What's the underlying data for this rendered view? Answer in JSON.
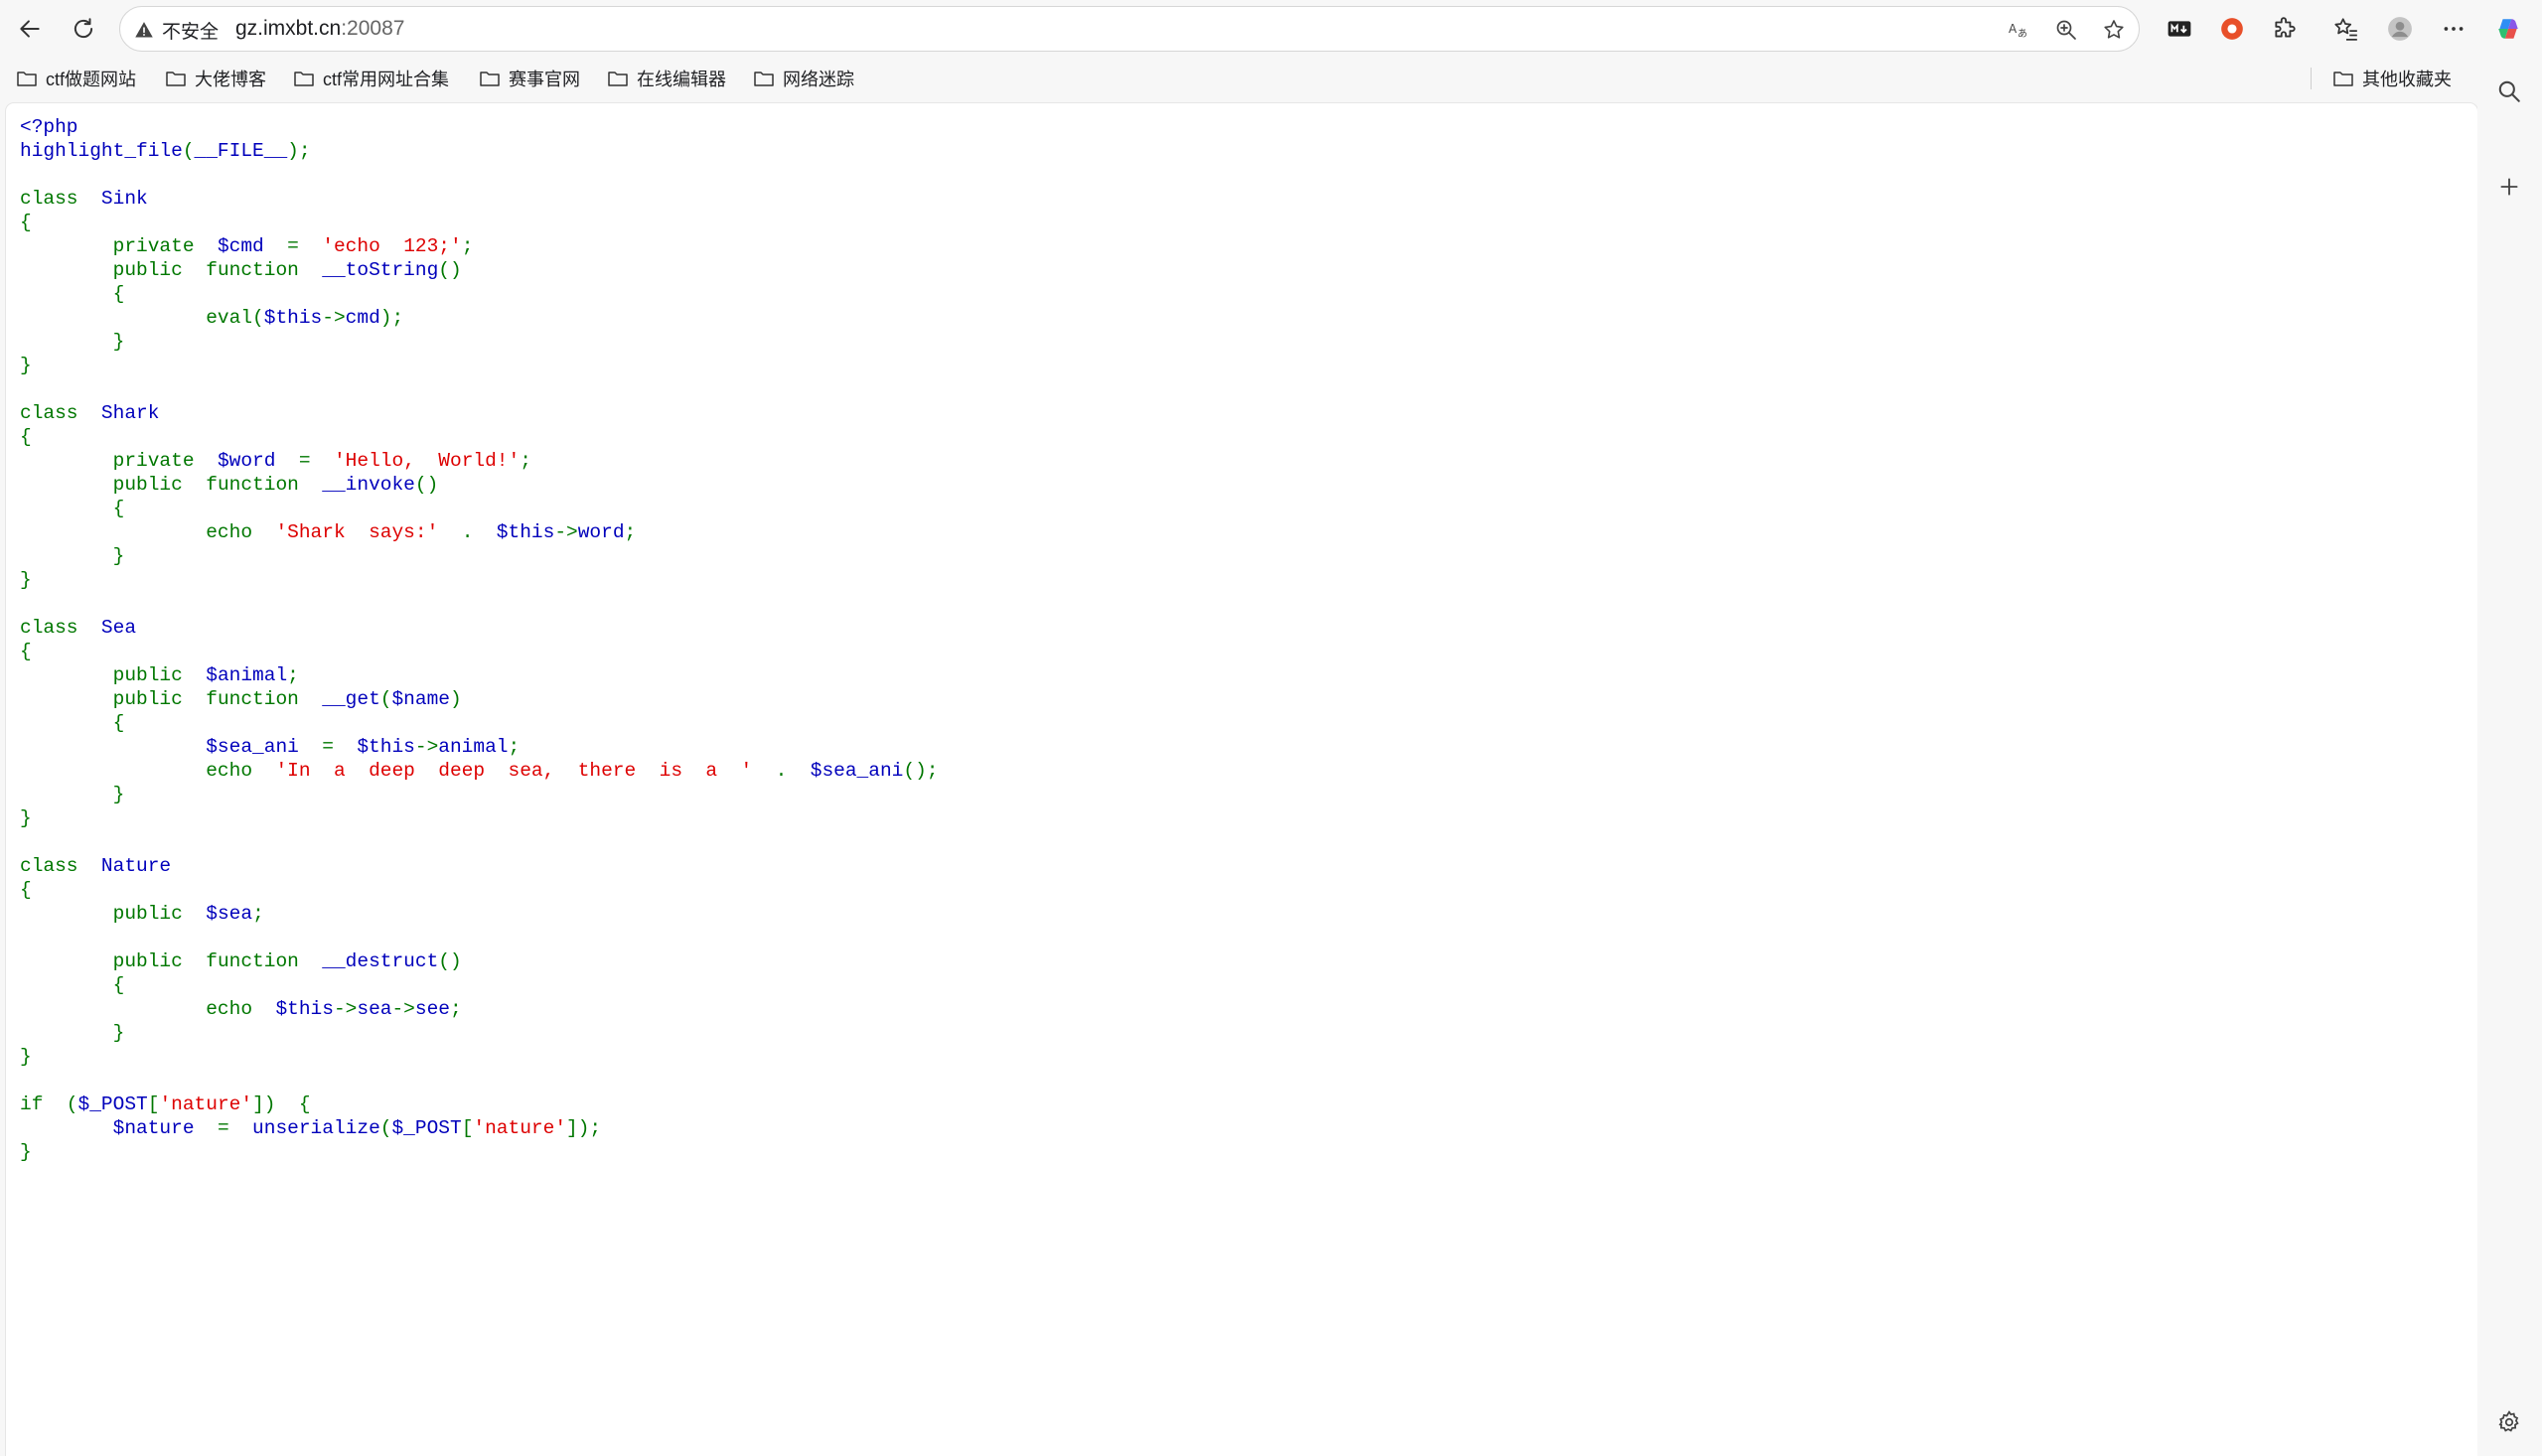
{
  "toolbar": {
    "security_label": "不安全",
    "url_host": "gz.imxbt.cn",
    "url_port": ":20087"
  },
  "bookmarks": [
    {
      "label": "ctf做题网站"
    },
    {
      "label": "大佬博客"
    },
    {
      "label": "ctf常用网址合集"
    },
    {
      "label": "赛事官网"
    },
    {
      "label": "在线编辑器"
    },
    {
      "label": "网络迷踪"
    }
  ],
  "other_bookmarks_label": "其他收藏夹",
  "code": {
    "lines": [
      [
        [
          "tag",
          "<?php"
        ]
      ],
      [
        [
          "def",
          "highlight_file"
        ],
        [
          "kw",
          "("
        ],
        [
          "def",
          "__FILE__"
        ],
        [
          "kw",
          ");"
        ]
      ],
      [],
      [
        [
          "kw",
          "class  "
        ],
        [
          "def",
          "Sink"
        ]
      ],
      [
        [
          "kw",
          "{"
        ]
      ],
      [
        [
          "def",
          "        "
        ],
        [
          "kw",
          "private  "
        ],
        [
          "def",
          "$cmd  "
        ],
        [
          "kw",
          "=  "
        ],
        [
          "str",
          "'echo  123;'"
        ],
        [
          "kw",
          ";"
        ]
      ],
      [
        [
          "def",
          "        "
        ],
        [
          "kw",
          "public  function  "
        ],
        [
          "def",
          "__toString"
        ],
        [
          "kw",
          "()"
        ]
      ],
      [
        [
          "def",
          "        "
        ],
        [
          "kw",
          "{"
        ]
      ],
      [
        [
          "def",
          "                "
        ],
        [
          "kw",
          "eval("
        ],
        [
          "def",
          "$this"
        ],
        [
          "kw",
          "->"
        ],
        [
          "def",
          "cmd"
        ],
        [
          "kw",
          ");"
        ]
      ],
      [
        [
          "def",
          "        "
        ],
        [
          "kw",
          "}"
        ]
      ],
      [
        [
          "kw",
          "}"
        ]
      ],
      [],
      [
        [
          "kw",
          "class  "
        ],
        [
          "def",
          "Shark"
        ]
      ],
      [
        [
          "kw",
          "{"
        ]
      ],
      [
        [
          "def",
          "        "
        ],
        [
          "kw",
          "private  "
        ],
        [
          "def",
          "$word  "
        ],
        [
          "kw",
          "=  "
        ],
        [
          "str",
          "'Hello,  World!'"
        ],
        [
          "kw",
          ";"
        ]
      ],
      [
        [
          "def",
          "        "
        ],
        [
          "kw",
          "public  function  "
        ],
        [
          "def",
          "__invoke"
        ],
        [
          "kw",
          "()"
        ]
      ],
      [
        [
          "def",
          "        "
        ],
        [
          "kw",
          "{"
        ]
      ],
      [
        [
          "def",
          "                "
        ],
        [
          "kw",
          "echo  "
        ],
        [
          "str",
          "'Shark  says:'  "
        ],
        [
          "kw",
          ".  "
        ],
        [
          "def",
          "$this"
        ],
        [
          "kw",
          "->"
        ],
        [
          "def",
          "word"
        ],
        [
          "kw",
          ";"
        ]
      ],
      [
        [
          "def",
          "        "
        ],
        [
          "kw",
          "}"
        ]
      ],
      [
        [
          "kw",
          "}"
        ]
      ],
      [],
      [
        [
          "kw",
          "class  "
        ],
        [
          "def",
          "Sea"
        ]
      ],
      [
        [
          "kw",
          "{"
        ]
      ],
      [
        [
          "def",
          "        "
        ],
        [
          "kw",
          "public  "
        ],
        [
          "def",
          "$animal"
        ],
        [
          "kw",
          ";"
        ]
      ],
      [
        [
          "def",
          "        "
        ],
        [
          "kw",
          "public  function  "
        ],
        [
          "def",
          "__get"
        ],
        [
          "kw",
          "("
        ],
        [
          "def",
          "$name"
        ],
        [
          "kw",
          ")"
        ]
      ],
      [
        [
          "def",
          "        "
        ],
        [
          "kw",
          "{"
        ]
      ],
      [
        [
          "def",
          "                $sea_ani  "
        ],
        [
          "kw",
          "=  "
        ],
        [
          "def",
          "$this"
        ],
        [
          "kw",
          "->"
        ],
        [
          "def",
          "animal"
        ],
        [
          "kw",
          ";"
        ]
      ],
      [
        [
          "def",
          "                "
        ],
        [
          "kw",
          "echo  "
        ],
        [
          "str",
          "'In  a  deep  deep  sea,  there  is  a  '  "
        ],
        [
          "kw",
          ".  "
        ],
        [
          "def",
          "$sea_ani"
        ],
        [
          "kw",
          "();"
        ]
      ],
      [
        [
          "def",
          "        "
        ],
        [
          "kw",
          "}"
        ]
      ],
      [
        [
          "kw",
          "}"
        ]
      ],
      [],
      [
        [
          "kw",
          "class  "
        ],
        [
          "def",
          "Nature"
        ]
      ],
      [
        [
          "kw",
          "{"
        ]
      ],
      [
        [
          "def",
          "        "
        ],
        [
          "kw",
          "public  "
        ],
        [
          "def",
          "$sea"
        ],
        [
          "kw",
          ";"
        ]
      ],
      [],
      [
        [
          "def",
          "        "
        ],
        [
          "kw",
          "public  function  "
        ],
        [
          "def",
          "__destruct"
        ],
        [
          "kw",
          "()"
        ]
      ],
      [
        [
          "def",
          "        "
        ],
        [
          "kw",
          "{"
        ]
      ],
      [
        [
          "def",
          "                "
        ],
        [
          "kw",
          "echo  "
        ],
        [
          "def",
          "$this"
        ],
        [
          "kw",
          "->"
        ],
        [
          "def",
          "sea"
        ],
        [
          "kw",
          "->"
        ],
        [
          "def",
          "see"
        ],
        [
          "kw",
          ";"
        ]
      ],
      [
        [
          "def",
          "        "
        ],
        [
          "kw",
          "}"
        ]
      ],
      [
        [
          "kw",
          "}"
        ]
      ],
      [],
      [
        [
          "kw",
          "if  ("
        ],
        [
          "def",
          "$_POST"
        ],
        [
          "kw",
          "["
        ],
        [
          "str",
          "'nature'"
        ],
        [
          "kw",
          "])  {"
        ]
      ],
      [
        [
          "def",
          "        $nature  "
        ],
        [
          "kw",
          "=  "
        ],
        [
          "def",
          "unserialize"
        ],
        [
          "kw",
          "("
        ],
        [
          "def",
          "$_POST"
        ],
        [
          "kw",
          "["
        ],
        [
          "str",
          "'nature'"
        ],
        [
          "kw",
          "]);"
        ]
      ],
      [
        [
          "kw",
          "}"
        ]
      ]
    ]
  },
  "colors": {
    "php_default": "#0000BB",
    "php_keyword": "#007700",
    "php_string": "#DD0000"
  },
  "icons": [
    "back-icon",
    "reload-icon",
    "warning-icon",
    "read-aloud-icon",
    "zoom-icon",
    "favorite-star-icon",
    "markdown-extension-icon",
    "record-extension-icon",
    "extensions-puzzle-icon",
    "favorites-icon",
    "profile-avatar",
    "more-icon",
    "copilot-icon",
    "folder-icon",
    "search-icon",
    "add-icon",
    "settings-icon"
  ]
}
